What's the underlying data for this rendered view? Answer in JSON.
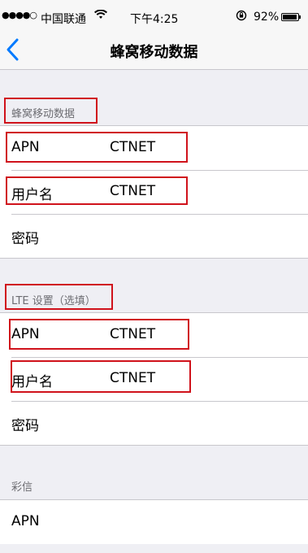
{
  "status_bar": {
    "signal": "●●●●○",
    "carrier": "中国联通",
    "time": "下午4:25",
    "battery_percent": "92%",
    "battery_level": 0.92
  },
  "nav": {
    "title": "蜂窝移动数据"
  },
  "sections": {
    "cellular": {
      "header": "蜂窝移动数据",
      "rows": [
        {
          "label": "APN",
          "value": "CTNET"
        },
        {
          "label": "用户名",
          "value": "CTNET"
        },
        {
          "label": "密码",
          "value": ""
        }
      ]
    },
    "lte": {
      "header": "LTE 设置（选填）",
      "rows": [
        {
          "label": "APN",
          "value": "CTNET"
        },
        {
          "label": "用户名",
          "value": "CTNET"
        },
        {
          "label": "密码",
          "value": ""
        }
      ]
    },
    "mms": {
      "header": "彩信",
      "rows": [
        {
          "label": "APN",
          "value": ""
        }
      ]
    }
  },
  "colors": {
    "highlight_box": "#d0121b",
    "back_chevron": "#007aff"
  }
}
